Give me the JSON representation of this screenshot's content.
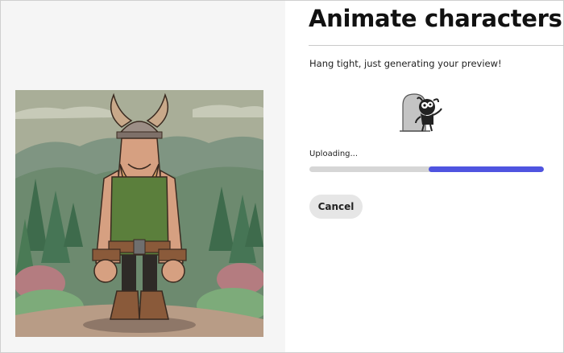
{
  "dialog": {
    "title": "Animate characters",
    "status_message": "Hang tight, just generating your preview!",
    "progress": {
      "label": "Uploading...",
      "fill_fraction": 0.49,
      "track_color": "#d6d6d6",
      "fill_color": "#4f54e0"
    },
    "cancel_label": "Cancel"
  },
  "preview": {
    "subject": "viking-character-illustration"
  },
  "spinner": {
    "icon": "loading-mascot-icon"
  }
}
